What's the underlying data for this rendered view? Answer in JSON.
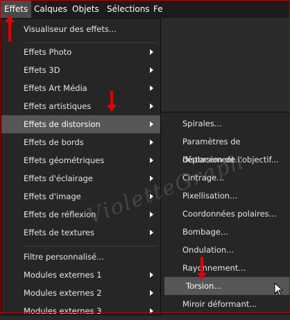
{
  "menubar": {
    "items": [
      {
        "label": "Effets",
        "active": true
      },
      {
        "label": "Calques"
      },
      {
        "label": "Objets"
      },
      {
        "label": "Sélections"
      },
      {
        "label": "Fe"
      }
    ]
  },
  "effects_menu": {
    "top_item": "Visualiseur des effets...",
    "items": [
      {
        "label": "Effets Photo",
        "submenu": true
      },
      {
        "label": "Effets 3D",
        "submenu": true
      },
      {
        "label": "Effets Art Média",
        "submenu": true
      },
      {
        "label": "Effets artistiques",
        "submenu": true
      },
      {
        "label": "Effets de distorsion",
        "submenu": true,
        "highlighted": true
      },
      {
        "label": "Effets de bords",
        "submenu": true
      },
      {
        "label": "Effets géométriques",
        "submenu": true
      },
      {
        "label": "Effets d'éclairage",
        "submenu": true
      },
      {
        "label": "Effets d'image",
        "submenu": true
      },
      {
        "label": "Effets de réflexion",
        "submenu": true
      },
      {
        "label": "Effets de textures",
        "submenu": true
      }
    ],
    "bottom_items": [
      {
        "label": "Filtre personnalisé..."
      },
      {
        "label": "Modules externes 1",
        "submenu": true
      },
      {
        "label": "Modules externes 2",
        "submenu": true
      },
      {
        "label": "Modules externes 3",
        "submenu": true
      }
    ]
  },
  "distortion_submenu": {
    "items": [
      {
        "label": "Spirales..."
      },
      {
        "label": "Paramètres de déplacement..."
      },
      {
        "label": "Distorsion de l'objectif..."
      },
      {
        "label": "Cintrage..."
      },
      {
        "label": "Pixellisation..."
      },
      {
        "label": "Coordonnées polaires..."
      },
      {
        "label": "Bombage..."
      },
      {
        "label": "Ondulation..."
      },
      {
        "label": "Rayonnement..."
      },
      {
        "label": "Torsion...",
        "highlighted": true
      },
      {
        "label": "Miroir déformant..."
      }
    ]
  },
  "watermark": "VioletteGraph",
  "colors": {
    "menubar_bg": "#1c1c1c",
    "menu_bg": "#262626",
    "highlight_bg": "#565656",
    "arrow_red": "#e30000",
    "frame_red": "#b40000"
  },
  "icons": [
    "red-arrow-up",
    "red-arrow-down",
    "submenu-arrow-icon",
    "mouse-cursor-icon"
  ]
}
